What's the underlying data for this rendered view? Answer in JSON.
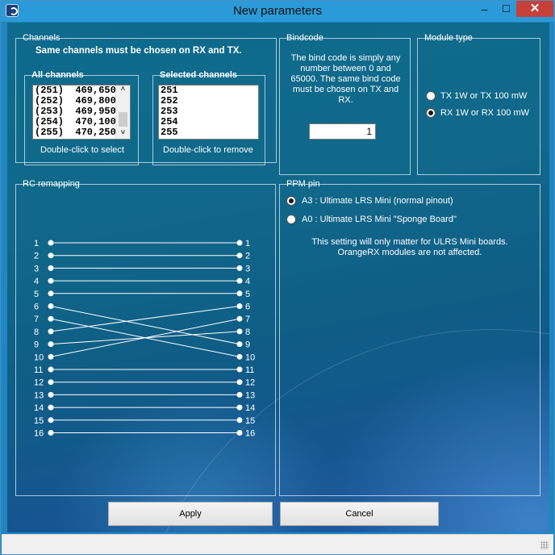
{
  "window": {
    "title": "New parameters",
    "minimize": "–",
    "maximize": "☐",
    "close": "✕"
  },
  "channels": {
    "legend": "Channels",
    "warning": "Same channels must be chosen on RX and TX.",
    "all_label": "All channels",
    "all_items": [
      "(251)  469,650 MH",
      "(252)  469,800 MH",
      "(253)  469,950 MH",
      "(254)  470,100 MH",
      "(255)  470,250 MH"
    ],
    "all_hint": "Double-click to select",
    "selected_label": "Selected channels",
    "selected_items": [
      "251",
      "252",
      "253",
      "254",
      "255"
    ],
    "selected_hint": "Double-click to remove"
  },
  "bindcode": {
    "legend": "Bindcode",
    "description": "The bind code is simply any number between 0 and 65000. The same bind code must be chosen on TX and RX.",
    "value": "1"
  },
  "module_type": {
    "legend": "Module type",
    "options": [
      {
        "label": "TX 1W or TX 100 mW",
        "checked": false
      },
      {
        "label": "RX 1W or RX 100 mW",
        "checked": true
      }
    ]
  },
  "rc_remapping": {
    "legend": "RC remapping",
    "left": [
      "1",
      "2",
      "3",
      "4",
      "5",
      "6",
      "7",
      "8",
      "9",
      "10",
      "11",
      "12",
      "13",
      "14",
      "15",
      "16"
    ],
    "right": [
      "1",
      "2",
      "3",
      "4",
      "5",
      "6",
      "7",
      "8",
      "9",
      "10",
      "11",
      "12",
      "13",
      "14",
      "15",
      "16"
    ],
    "mapping": [
      [
        1,
        1
      ],
      [
        2,
        2
      ],
      [
        3,
        3
      ],
      [
        4,
        4
      ],
      [
        5,
        5
      ],
      [
        6,
        9
      ],
      [
        7,
        10
      ],
      [
        8,
        6
      ],
      [
        9,
        8
      ],
      [
        10,
        7
      ],
      [
        11,
        11
      ],
      [
        12,
        12
      ],
      [
        13,
        13
      ],
      [
        14,
        14
      ],
      [
        15,
        15
      ],
      [
        16,
        16
      ]
    ]
  },
  "ppm_pin": {
    "legend": "PPM pin",
    "options": [
      {
        "label": "A3 : Ultimate LRS Mini (normal pinout)",
        "checked": true
      },
      {
        "label": "A0 : Ultimate LRS Mini \"Sponge Board\"",
        "checked": false
      }
    ],
    "note_line1": "This setting will only matter for ULRS Mini boards.",
    "note_line2": "OrangeRX modules are not affected."
  },
  "buttons": {
    "apply": "Apply",
    "cancel": "Cancel"
  },
  "colors": {
    "title_bar": "#2b9ad8",
    "close_button": "#c7403a"
  }
}
